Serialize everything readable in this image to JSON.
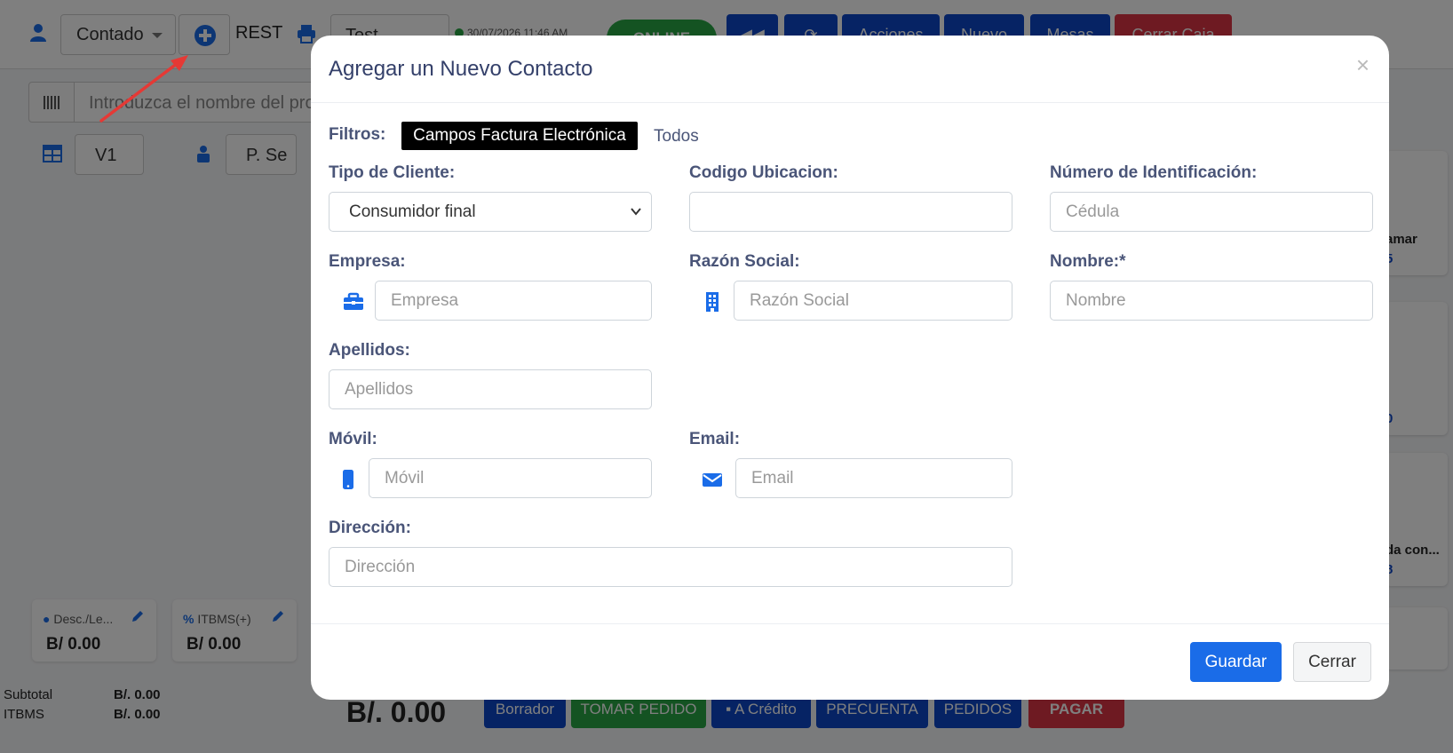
{
  "background": {
    "topbar": {
      "customer_select": "Contado",
      "rest_label": "REST",
      "test_select": "Test",
      "datetime": "30/07/2026 11:46 AM",
      "online_label": "ONLINE",
      "buttons": [
        "Acciones",
        "Nuevo",
        "Mesas",
        "Cerrar Caja"
      ]
    },
    "search": {
      "placeholder": "Introduzca el nombre del producto"
    },
    "row2": {
      "version_select": "V1",
      "seller_select": "P. Se"
    },
    "right_cards": [
      {
        "label": "amar",
        "value": "5"
      },
      {
        "label": "",
        "value": "0"
      },
      {
        "label": "da con...",
        "value": "8"
      },
      {
        "label": "",
        "value": ""
      }
    ],
    "summary_cards": [
      {
        "title": "Desc./Le...",
        "value": "B/ 0.00"
      },
      {
        "title": "ITBMS(+)",
        "value": "B/ 0.00"
      }
    ],
    "totals": [
      {
        "label": "Subtotal",
        "value": "B/. 0.00"
      },
      {
        "label": "ITBMS",
        "value": "B/. 0.00"
      }
    ],
    "grand_total": "B/. 0.00",
    "bottom_buttons": [
      "Borrador",
      "TOMAR PEDIDO",
      "A Crédito",
      "PRECUENTA",
      "PEDIDOS",
      "PAGAR"
    ]
  },
  "modal": {
    "title": "Agregar un Nuevo Contacto",
    "close_symbol": "×",
    "filters_label": "Filtros:",
    "filter_active": "Campos Factura Electrónica",
    "filter_other": "Todos",
    "fields": {
      "tipo_cliente": {
        "label": "Tipo de Cliente:",
        "value": "Consumidor final"
      },
      "codigo_ubicacion": {
        "label": "Codigo Ubicacion:",
        "value": ""
      },
      "numero_identificacion": {
        "label": "Número de Identificación:",
        "placeholder": "Cédula"
      },
      "empresa": {
        "label": "Empresa:",
        "placeholder": "Empresa"
      },
      "razon_social": {
        "label": "Razón Social:",
        "placeholder": "Razón Social"
      },
      "nombre": {
        "label": "Nombre:*",
        "placeholder": "Nombre"
      },
      "apellidos": {
        "label": "Apellidos:",
        "placeholder": "Apellidos"
      },
      "movil": {
        "label": "Móvil:",
        "placeholder": "Móvil"
      },
      "email": {
        "label": "Email:",
        "placeholder": "Email"
      },
      "direccion": {
        "label": "Dirección:",
        "placeholder": "Dirección"
      }
    },
    "save_label": "Guardar",
    "close_label": "Cerrar"
  },
  "colors": {
    "accent": "#1a6ce8",
    "label": "#4a5578",
    "title": "#34406a",
    "arrow": "#e53935"
  }
}
